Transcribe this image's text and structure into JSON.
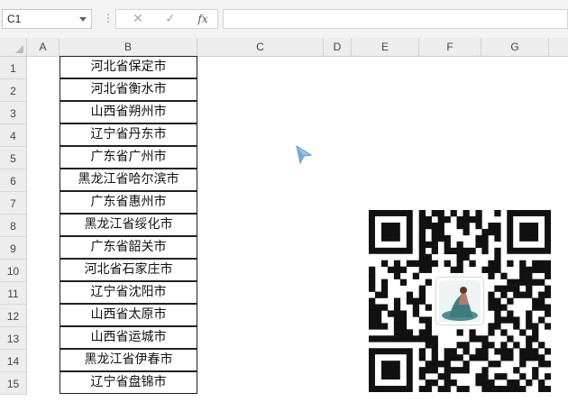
{
  "formula_bar": {
    "name_box": "C1",
    "cancel_icon": "✕",
    "enter_icon": "✓",
    "function_icon": "fx",
    "formula_value": ""
  },
  "columns": [
    "A",
    "B",
    "C",
    "D",
    "E",
    "F",
    "G"
  ],
  "rows": [
    "1",
    "2",
    "3",
    "4",
    "5",
    "6",
    "7",
    "8",
    "9",
    "10",
    "11",
    "12",
    "13",
    "14",
    "15"
  ],
  "cells_B": [
    "河北省保定市",
    "河北省衡水市",
    "山西省朔州市",
    "辽宁省丹东市",
    "广东省广州市",
    "黑龙江省哈尔滨市",
    "广东省惠州市",
    "黑龙江省绥化市",
    "广东省韶关市",
    "河北省石家庄市",
    "辽宁省沈阳市",
    "山西省太原市",
    "山西省运城市",
    "黑龙江省伊春市",
    "辽宁省盘锦市"
  ],
  "icons": {
    "cursor": "mouse-pointer-icon",
    "qr": "qr-code-image"
  },
  "colors": {
    "qr_dark": "#111111",
    "header_bg": "#ededed"
  }
}
